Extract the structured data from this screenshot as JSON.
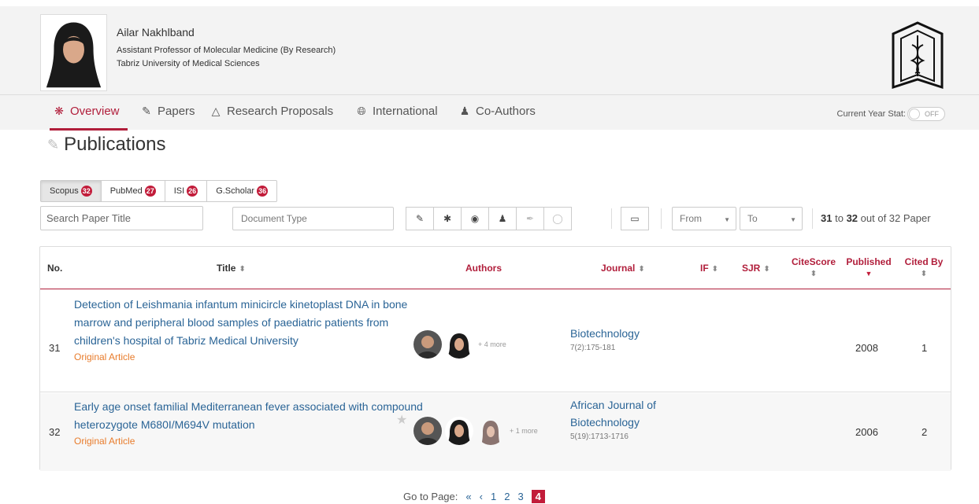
{
  "profile": {
    "name": "Ailar Nakhlband",
    "position": "Assistant Professor of Molecular Medicine (By Research)",
    "university": "Tabriz University of Medical Sciences"
  },
  "nav": {
    "items": [
      {
        "label": "Overview",
        "icon": "network-icon",
        "active": true
      },
      {
        "label": "Papers",
        "icon": "pencil-icon"
      },
      {
        "label": "Research Proposals",
        "icon": "flask-icon"
      },
      {
        "label": "International",
        "icon": "globe-icon"
      },
      {
        "label": "Co-Authors",
        "icon": "users-icon"
      }
    ],
    "year_stat_label": "Current Year Stat:",
    "toggle_state": "OFF"
  },
  "page_title": "Publications",
  "sources": [
    {
      "label": "Scopus",
      "count": "32",
      "active": true
    },
    {
      "label": "PubMed",
      "count": "27"
    },
    {
      "label": "ISI",
      "count": "26"
    },
    {
      "label": "G.Scholar",
      "count": "36"
    }
  ],
  "filters": {
    "search_placeholder": "Search Paper Title",
    "doc_type_placeholder": "Document Type",
    "from_label": "From",
    "to_label": "To"
  },
  "paging_info": {
    "from": "31",
    "to_word": "to",
    "to": "32",
    "suffix": "out of 32 Paper"
  },
  "table": {
    "headers": {
      "no": "No.",
      "title": "Title",
      "authors": "Authors",
      "journal": "Journal",
      "if": "IF",
      "sjr": "SJR",
      "citescore": "CiteScore",
      "published": "Published",
      "cited": "Cited By"
    },
    "rows": [
      {
        "no": "31",
        "title": "Detection of Leishmania infantum minicircle kinetoplast DNA in bone marrow and peripheral blood samples of paediatric patients from children's hospital of Tabriz Medical University",
        "type": "Original Article",
        "more": "+ 4 more",
        "journal": "Biotechnology",
        "pages": "7(2):175-181",
        "published": "2008",
        "cited": "1"
      },
      {
        "no": "32",
        "title": "Early age onset familial Mediterranean fever associated with compound heterozygote M680I/M694V mutation",
        "type": "Original Article",
        "more": "+ 1 more",
        "journal": "African Journal of Biotechnology",
        "pages": "5(19):1713-1716",
        "published": "2006",
        "cited": "2"
      }
    ]
  },
  "pagination": {
    "label": "Go to Page:",
    "first": "«",
    "prev": "‹",
    "pages": [
      "1",
      "2",
      "3",
      "4"
    ],
    "current": "4"
  },
  "colors": {
    "accent": "#b11e3b",
    "link": "#2a6496",
    "article_type": "#e87c2c"
  }
}
